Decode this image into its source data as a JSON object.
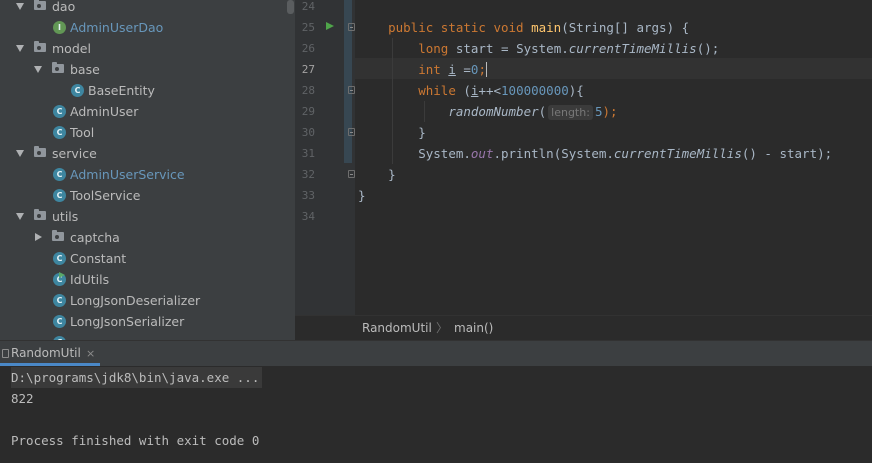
{
  "project_tree": {
    "items": [
      {
        "label": "dao",
        "kind": "folder",
        "expanded": true,
        "icon": "folder-icon"
      },
      {
        "label": "AdminUserDao",
        "kind": "interface",
        "icon": "interface-icon",
        "modified": true
      },
      {
        "label": "model",
        "kind": "folder",
        "expanded": true,
        "icon": "folder-icon"
      },
      {
        "label": "base",
        "kind": "folder",
        "expanded": true,
        "icon": "folder-icon"
      },
      {
        "label": "BaseEntity",
        "kind": "class",
        "icon": "class-icon"
      },
      {
        "label": "AdminUser",
        "kind": "class",
        "icon": "class-icon"
      },
      {
        "label": "Tool",
        "kind": "class",
        "icon": "class-icon"
      },
      {
        "label": "service",
        "kind": "folder",
        "expanded": true,
        "icon": "folder-icon"
      },
      {
        "label": "AdminUserService",
        "kind": "class",
        "icon": "class-icon",
        "modified": true
      },
      {
        "label": "ToolService",
        "kind": "class",
        "icon": "class-icon"
      },
      {
        "label": "utils",
        "kind": "folder",
        "expanded": true,
        "icon": "folder-icon"
      },
      {
        "label": "captcha",
        "kind": "folder",
        "expanded": false,
        "icon": "folder-icon"
      },
      {
        "label": "Constant",
        "kind": "class",
        "icon": "class-icon"
      },
      {
        "label": "IdUtils",
        "kind": "class-runnable",
        "icon": "runnable-class-icon"
      },
      {
        "label": "LongJsonDeserializer",
        "kind": "class",
        "icon": "class-icon"
      },
      {
        "label": "LongJsonSerializer",
        "kind": "class",
        "icon": "class-icon"
      }
    ]
  },
  "editor": {
    "line_numbers": [
      "24",
      "25",
      "26",
      "27",
      "28",
      "29",
      "30",
      "31",
      "32",
      "33",
      "34"
    ],
    "current_line": "27",
    "code": {
      "l25": {
        "kw1": "public static void ",
        "fn": "main",
        "rest": "(String[] args) {"
      },
      "l26": {
        "kw": "long ",
        "mid": "start = System.",
        "it": "currentTimeMillis",
        "end": "();"
      },
      "l27": {
        "kw": "int ",
        "var": "i",
        "mid": " =",
        "num": "0",
        "end": ";"
      },
      "l28": {
        "kw": "while ",
        "open": "(",
        "var": "i",
        "mid": "++<",
        "num": "100000000",
        "end": "){"
      },
      "l29": {
        "it": "randomNumber",
        "open": "(",
        "hint": "length:",
        "num": "5",
        "end": ");"
      },
      "l30": "}",
      "l31": {
        "pre": "System.",
        "field": "out",
        "mid": ".println(System.",
        "it": "currentTimeMillis",
        "end": "() - start);"
      },
      "l32": "}",
      "l33": "}"
    },
    "param_hint_icon": "parameter-hint"
  },
  "breadcrumb": {
    "file": "RandomUtil",
    "separator": "〉",
    "method": "main()"
  },
  "run_panel": {
    "tab_label": "RandomUtil",
    "tab_close": "×",
    "lines": [
      "D:\\programs\\jdk8\\bin\\java.exe ...",
      "822",
      "",
      "Process finished with exit code 0"
    ]
  },
  "colors": {
    "keyword": "#cc7832",
    "method_decl": "#ffc66d",
    "number": "#6897bb",
    "field": "#9876aa",
    "vcs_modified": "#6897bb",
    "run_icon": "#4fa54a"
  }
}
